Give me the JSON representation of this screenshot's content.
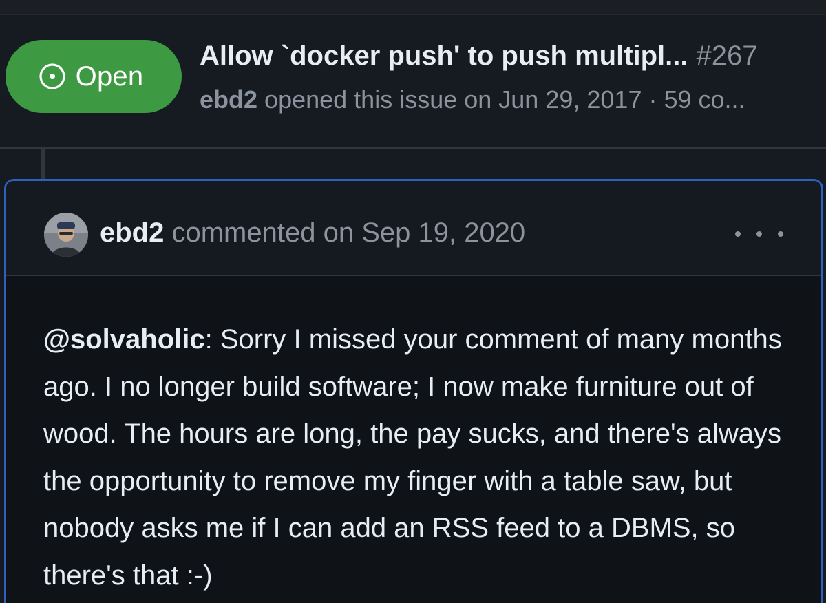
{
  "issue": {
    "status_label": "Open",
    "status_icon": "issue-opened-icon",
    "title": "Allow `docker push' to push multipl...",
    "number": "#267",
    "author": "ebd2",
    "meta_text": "opened this issue on Jun 29, 2017 · 59 co..."
  },
  "comment": {
    "author": "ebd2",
    "action_text": "commented on Sep 19, 2020",
    "menu_icon": "kebab-horizontal-icon",
    "mention": "@solvaholic",
    "body_text": ": Sorry I missed your comment of many months ago. I no longer build software; I now make furniture out of wood. The hours are long, the pay sucks, and there's always the opportunity to remove my finger with a table saw, but nobody asks me if I can add an RSS feed to a DBMS, so there's that :-)"
  },
  "colors": {
    "background": "#161b22",
    "open_badge": "#3d9a43",
    "comment_border": "#2f5fbf",
    "text_primary": "#e6edf3",
    "text_muted": "#8b949e"
  }
}
